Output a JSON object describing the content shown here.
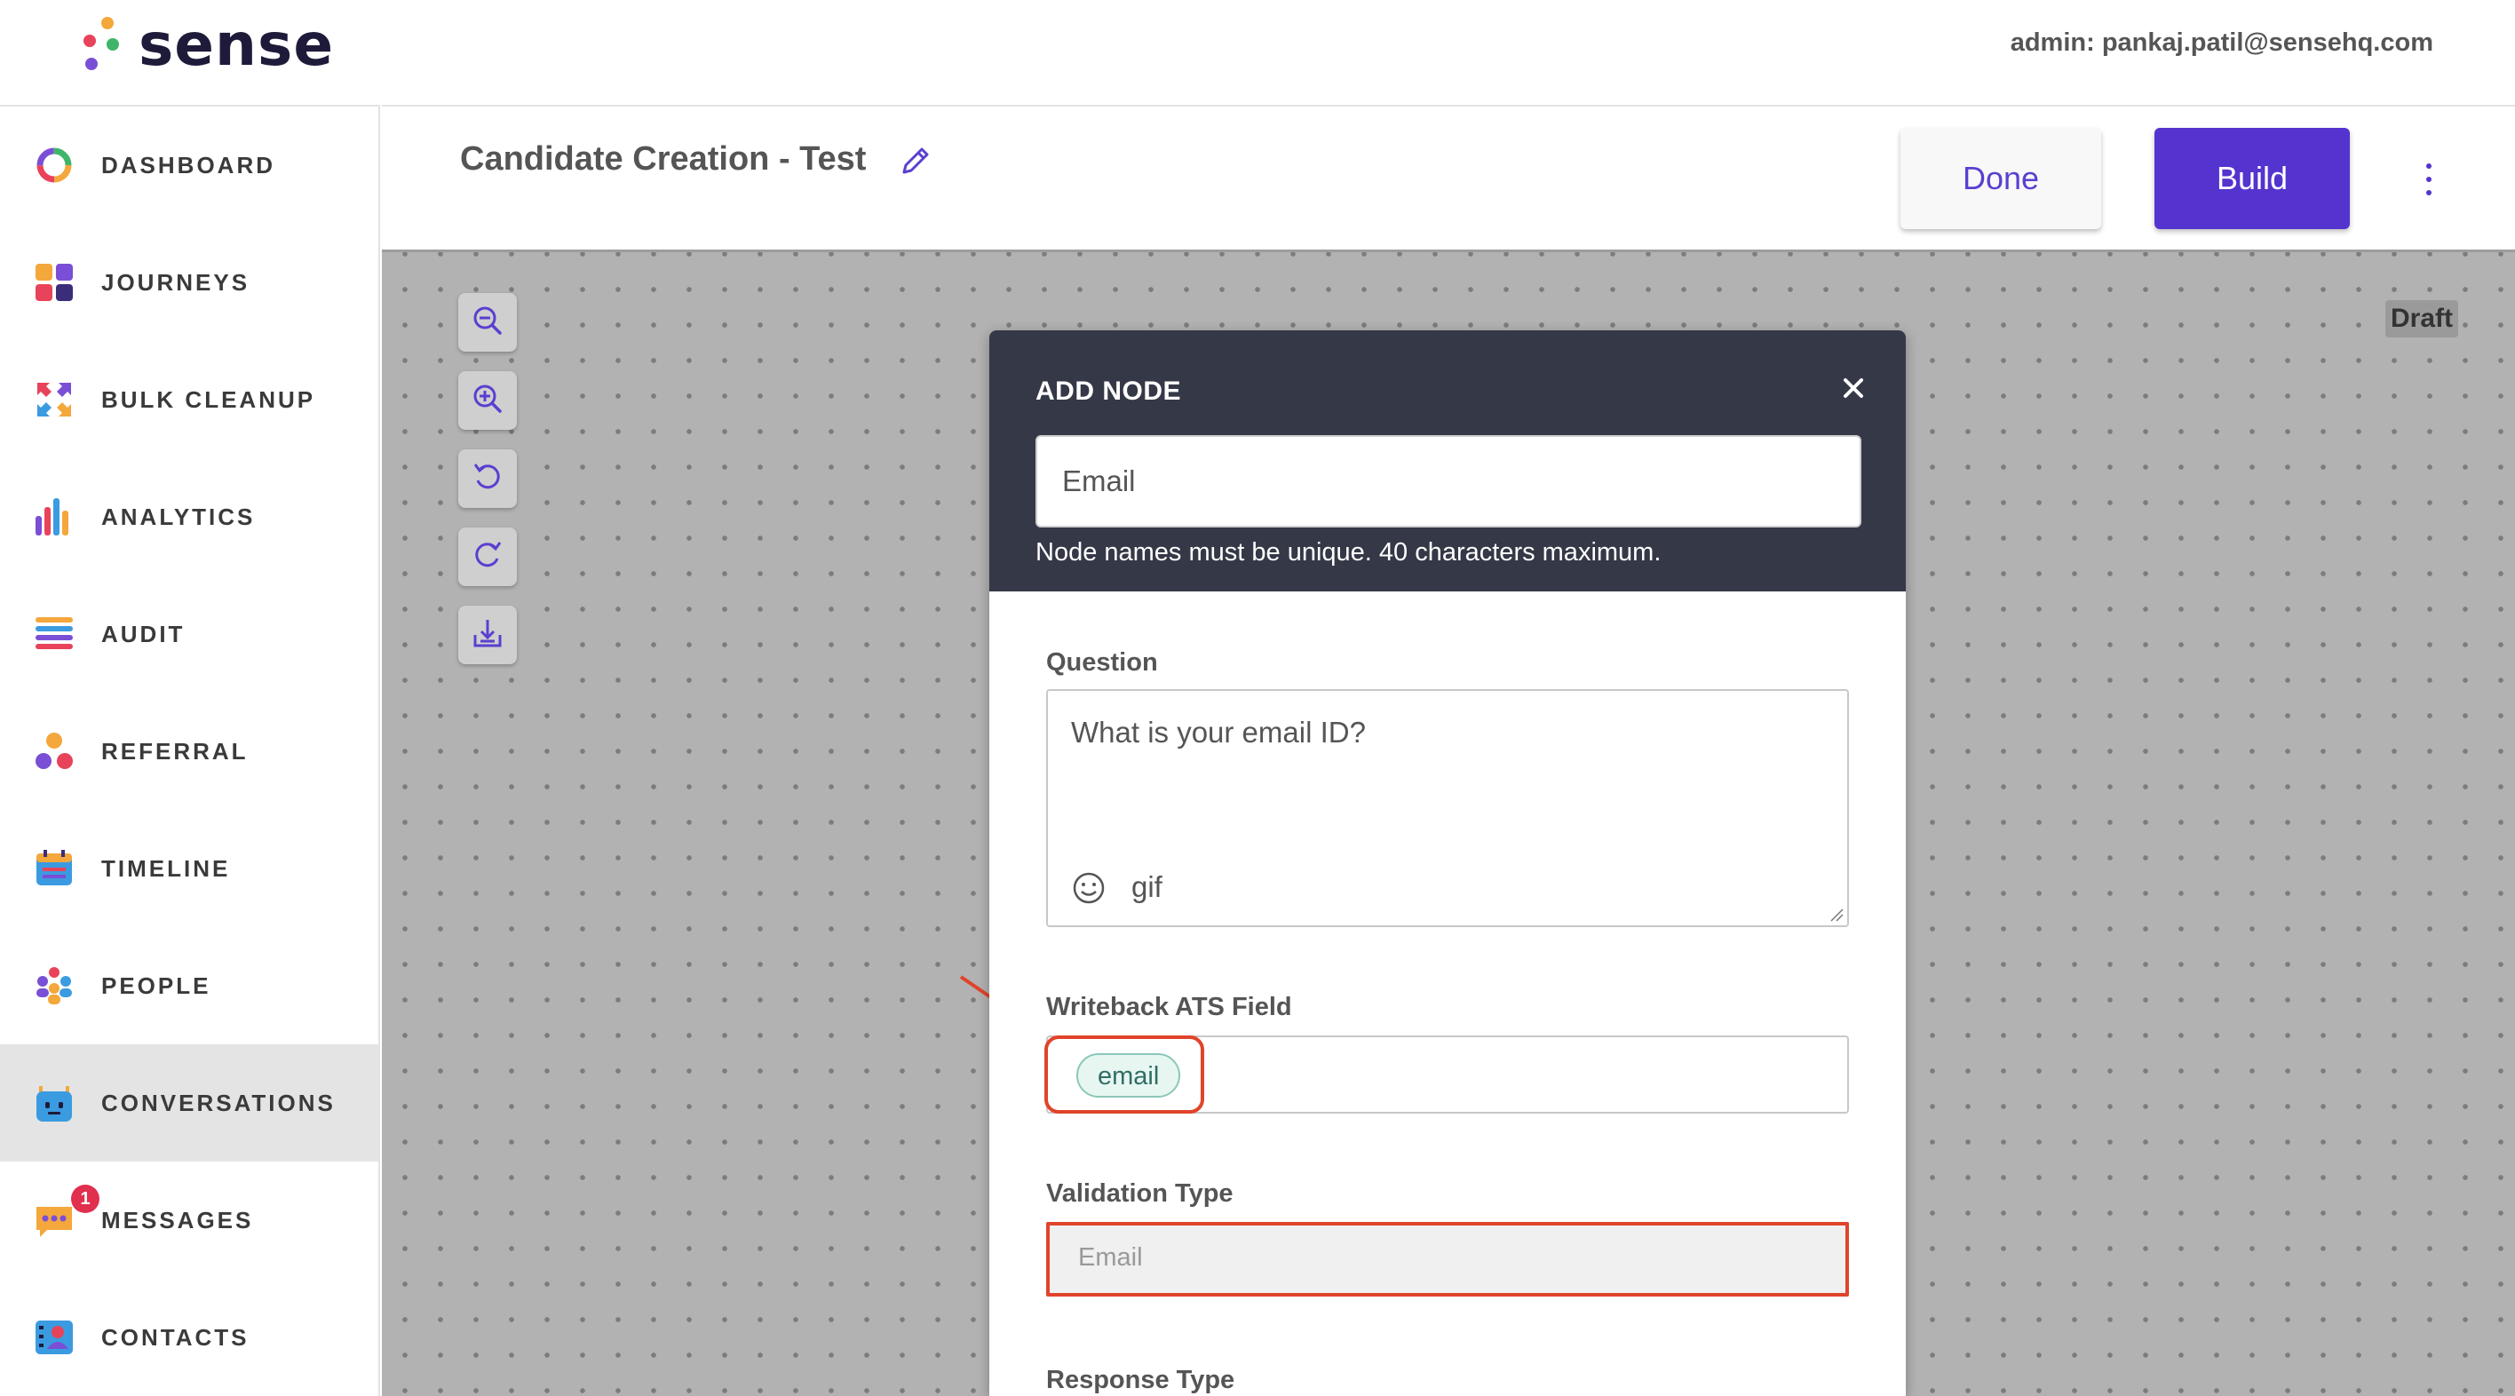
{
  "brand": {
    "name": "sense"
  },
  "header": {
    "admin": "admin: pankaj.patil@sensehq.com"
  },
  "sidebar": {
    "items": [
      {
        "label": "DASHBOARD",
        "icon": "dashboard-ring-icon"
      },
      {
        "label": "JOURNEYS",
        "icon": "journeys-grid-icon"
      },
      {
        "label": "BULK CLEANUP",
        "icon": "bulk-cleanup-arrows-icon"
      },
      {
        "label": "ANALYTICS",
        "icon": "analytics-bars-icon"
      },
      {
        "label": "AUDIT",
        "icon": "audit-list-icon"
      },
      {
        "label": "REFERRAL",
        "icon": "referral-dots-icon"
      },
      {
        "label": "TIMELINE",
        "icon": "timeline-calendar-icon"
      },
      {
        "label": "PEOPLE",
        "icon": "people-group-icon"
      },
      {
        "label": "CONVERSATIONS",
        "icon": "conversations-bot-icon",
        "active": true
      },
      {
        "label": "MESSAGES",
        "icon": "messages-chat-icon",
        "badge": "1"
      },
      {
        "label": "CONTACTS",
        "icon": "contacts-card-icon"
      }
    ]
  },
  "toolbar": {
    "title": "Candidate Creation - Test",
    "done_label": "Done",
    "build_label": "Build"
  },
  "canvas": {
    "status": "Draft"
  },
  "modal": {
    "title": "ADD NODE",
    "node_name": "Email",
    "node_hint": "Node names must be unique. 40 characters maximum.",
    "question_label": "Question",
    "question_text": "What is your email ID?",
    "gif_label": "gif",
    "ats_label": "Writeback ATS Field",
    "ats_chip": "email",
    "validation_label": "Validation Type",
    "validation_value": "Email",
    "response_label": "Response Type"
  },
  "colors": {
    "accent": "#5433cf",
    "modal_header": "#353846",
    "highlight": "#e0442a",
    "badge": "#e0304e"
  }
}
